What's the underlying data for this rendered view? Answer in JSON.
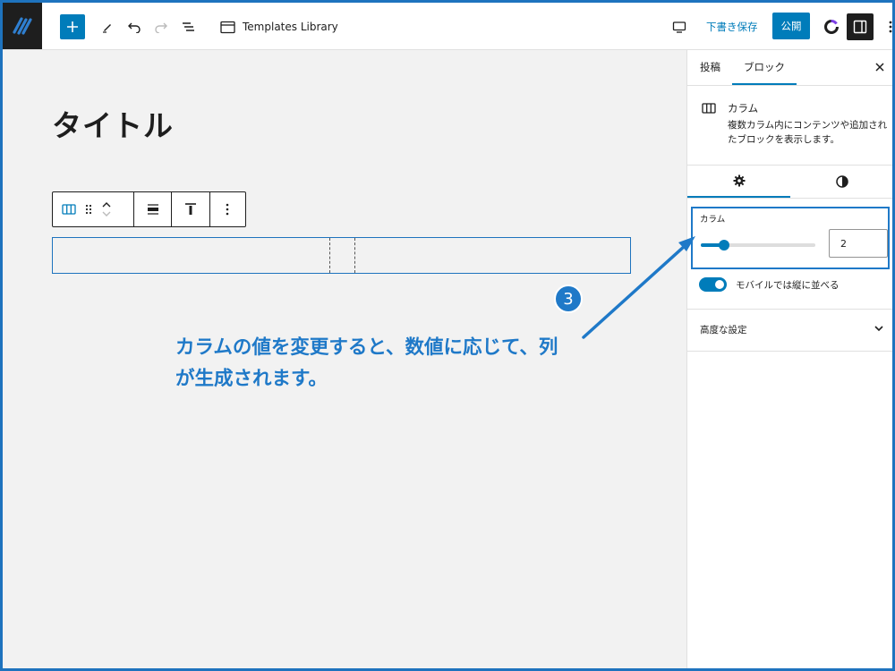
{
  "toolbar": {
    "document_title": "Templates Library",
    "save_draft_label": "下書き保存",
    "publish_label": "公開"
  },
  "editor": {
    "post_title": "タイトル"
  },
  "sidebar": {
    "tabs": [
      "投稿",
      "ブロック"
    ],
    "active_tab": "ブロック",
    "block": {
      "name": "カラム",
      "description": "複数カラム内にコンテンツや追加されたブロックを表示します。"
    },
    "columns_control": {
      "label": "カラム",
      "value": "2",
      "slider_fraction": 0.2
    },
    "stack_on_mobile": {
      "label": "モバイルでは縦に並べる",
      "enabled": true
    },
    "advanced_label": "高度な設定"
  },
  "annotation": {
    "text": "カラムの値を変更すると、数値に応じて、列が生成されます。",
    "step": "3"
  },
  "colors": {
    "accent": "#007cba",
    "annotation": "#1f79c8",
    "frame": "#1e73be"
  },
  "icons": [
    "wp-logo-icon",
    "plus-icon",
    "pencil-icon",
    "undo-icon",
    "redo-icon",
    "list-view-icon",
    "browser-icon",
    "desktop-preview-icon",
    "options-ring-icon",
    "sidebar-toggle-icon",
    "more-vertical-icon",
    "columns-icon",
    "drag-handle-icon",
    "chevron-up-icon",
    "chevron-down-icon",
    "align-icon",
    "vertical-align-top-icon",
    "close-icon",
    "gear-icon",
    "contrast-icon"
  ]
}
